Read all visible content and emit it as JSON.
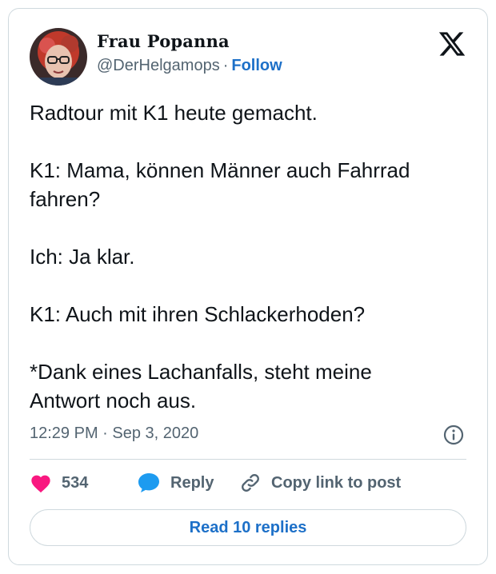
{
  "author": {
    "display_name": "Frau Popanna",
    "handle": "@DerHelgamops",
    "separator": "·",
    "follow_label": "Follow"
  },
  "tweet": {
    "paragraphs": [
      "Radtour mit K1 heute gemacht.",
      "K1: Mama, können Männer auch Fahrrad\nfahren?",
      "Ich: Ja klar.",
      "K1: Auch mit ihren Schlackerhoden?",
      "*Dank eines Lachanfalls, steht meine\nAntwort noch aus."
    ],
    "timestamp": "12:29 PM · Sep 3, 2020"
  },
  "actions": {
    "like_count": "534",
    "reply_label": "Reply",
    "copy_link_label": "Copy link to post"
  },
  "read_replies_label": "Read 10 replies",
  "colors": {
    "accent": "#1d70c8",
    "like": "#f91880",
    "reply": "#1d9bf0",
    "secondary_text": "#536471",
    "border": "#cfd9de"
  },
  "icons": {
    "logo": "x-logo-icon",
    "info": "info-icon",
    "like": "heart-icon",
    "reply": "speech-bubble-icon",
    "copy_link": "link-icon"
  }
}
